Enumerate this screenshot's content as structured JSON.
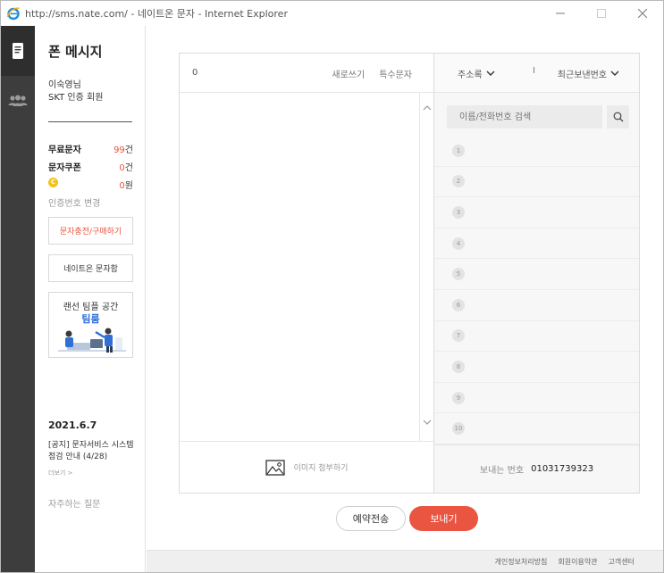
{
  "window": {
    "title": "http://sms.nate.com/ - 네이트온 문자 - Internet Explorer"
  },
  "rail": {
    "items": [
      {
        "icon": "phone-message-icon",
        "active": true
      },
      {
        "icon": "people-icon",
        "active": false
      }
    ]
  },
  "left": {
    "title": "폰 메시지",
    "user_name": "이숙영님",
    "user_auth": "SKT 인증 회원",
    "free_sms_label": "무료문자",
    "free_sms_count": "99",
    "free_sms_unit": "건",
    "coupon_label": "문자쿠폰",
    "coupon_count": "0",
    "coupon_unit": "건",
    "coin_symbol": "C",
    "coin_count": "0",
    "coin_unit": "원",
    "change_auth_link": "인증번호 변경",
    "charge_button": "문자충전/구매하기",
    "nateon_sms_button": "네이트온 문자함",
    "ad_line1": "랜선 팀플 공간",
    "ad_line2": "팀룸",
    "notice_date": "2021.6.7",
    "notice_text": "[공지] 문자서비스 시스템 점검 안내 (4/28)",
    "more_link": "더보기 >",
    "faq_link": "자주하는 질문"
  },
  "compose": {
    "char_count": "0",
    "new_write": "새로쓰기",
    "special_chars": "특수문자",
    "attach_image": "이미지 첨부하기"
  },
  "address": {
    "address_book": "주소록",
    "separator": "I",
    "recent_numbers": "최근보낸번호",
    "search_placeholder": "이름/전화번호 검색",
    "recipients": [
      "1",
      "2",
      "3",
      "4",
      "5",
      "6",
      "7",
      "8",
      "9",
      "10"
    ],
    "sender_label": "보내는 번호",
    "sender_number": "01031739323"
  },
  "actions": {
    "reserve": "예약전송",
    "send": "보내기"
  },
  "footer": {
    "privacy": "개인정보처리방침",
    "terms": "회원이용약관",
    "support": "고객센터"
  },
  "colors": {
    "accent": "#ea5541",
    "rail": "#3d3d3d",
    "ad_blue": "#2f6fd6"
  }
}
